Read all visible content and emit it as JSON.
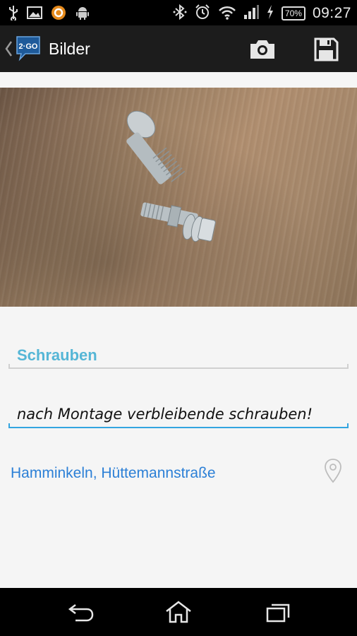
{
  "status_bar": {
    "time": "09:27",
    "battery": "70%",
    "left_icons": [
      "usb-icon",
      "image-icon",
      "sync-app-icon",
      "android-icon"
    ],
    "right_icons": [
      "bluetooth-icon",
      "alarm-icon",
      "wifi-icon",
      "signal-icon",
      "charging-icon"
    ]
  },
  "action_bar": {
    "logo_text": "2·GO",
    "title": "Bilder",
    "actions": [
      "camera-icon",
      "save-icon"
    ]
  },
  "photo": {
    "subject": "schrauben-photo"
  },
  "form": {
    "title_value": "Schrauben",
    "description_value": "nach Montage verbleibende schrauben!",
    "location": "Hamminkeln, Hüttemannstraße"
  },
  "nav_bar": {
    "buttons": [
      "back-icon",
      "home-icon",
      "recent-apps-icon"
    ]
  },
  "colors": {
    "accent_blue": "#33a5e0",
    "title_blue": "#55b6d6",
    "link_blue": "#2b7fd6",
    "bar_dark": "#1c1c1c"
  }
}
